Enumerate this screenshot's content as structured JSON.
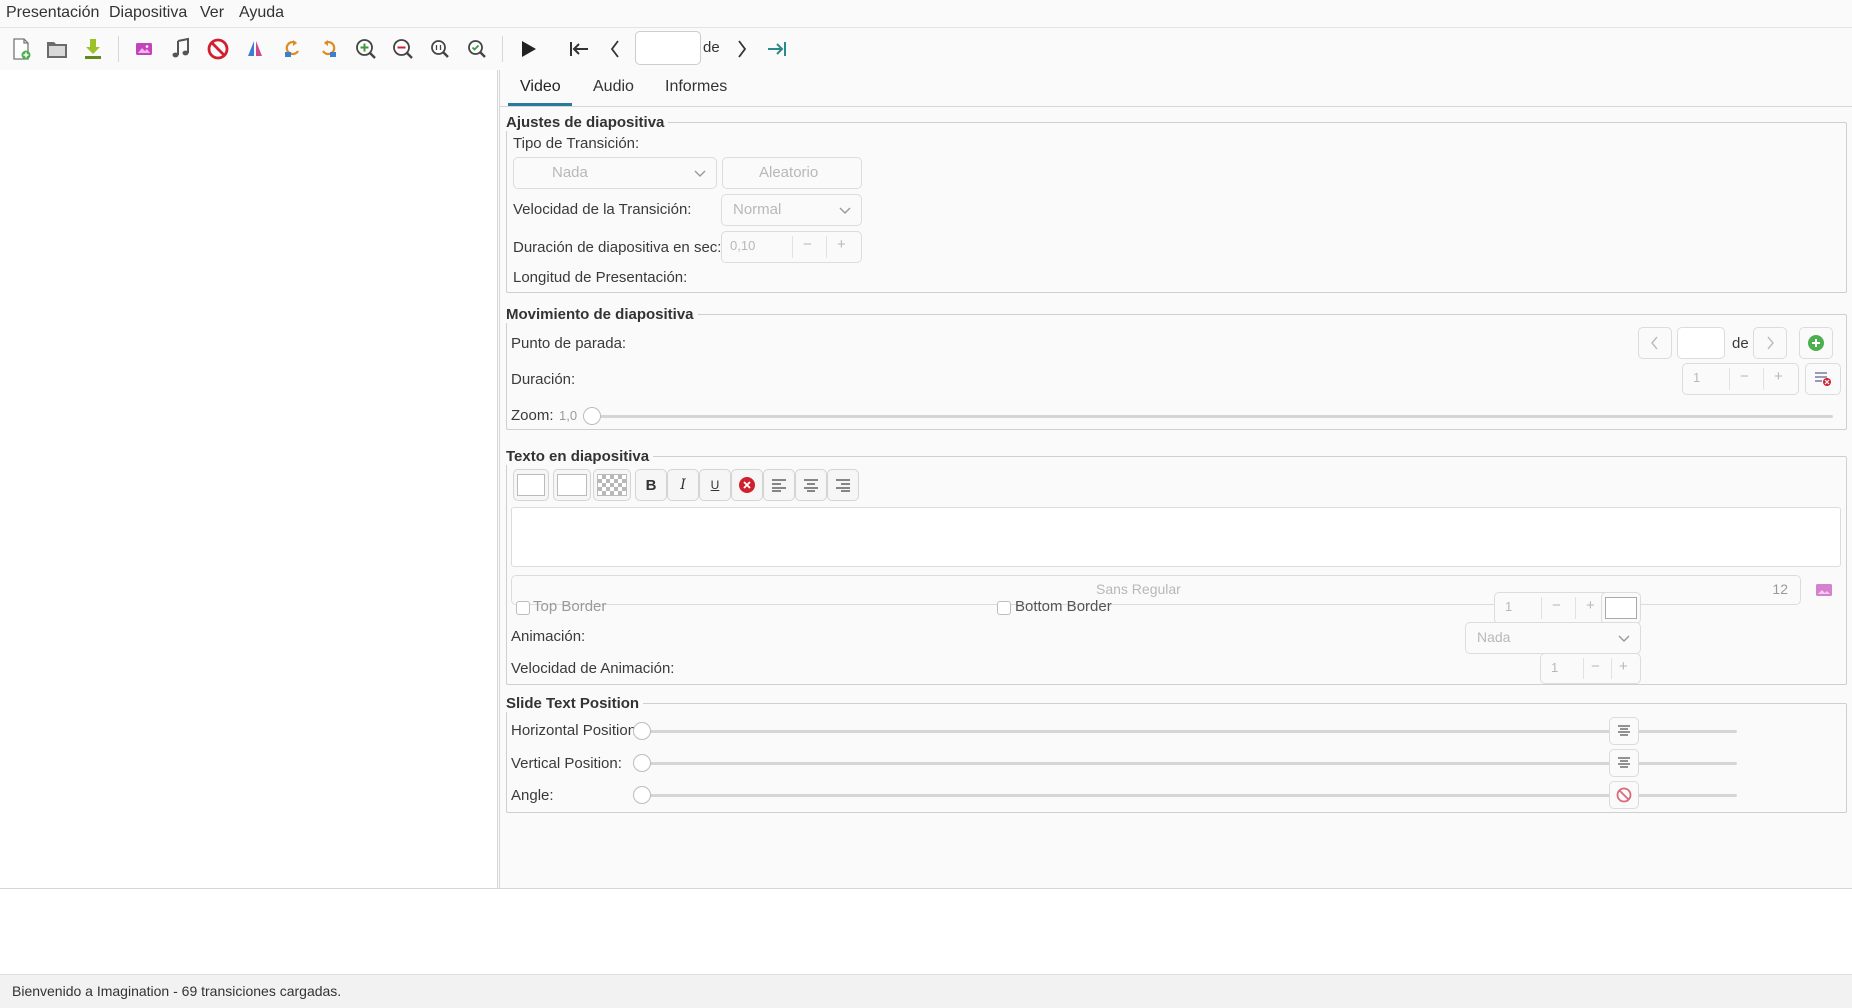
{
  "menubar": {
    "items": [
      "Presentación",
      "Diapositiva",
      "Ver",
      "Ayuda"
    ]
  },
  "toolbar": {
    "icons": [
      "new-document-icon",
      "open-folder-icon",
      "save-download-icon",
      "import-image-icon",
      "import-music-icon",
      "delete-icon",
      "flip-icon",
      "rotate-left-icon",
      "rotate-right-icon",
      "zoom-in-icon",
      "zoom-out-icon",
      "zoom-normal-icon",
      "zoom-fit-icon",
      "play-icon",
      "first-slide-icon",
      "previous-slide-icon",
      "next-slide-icon",
      "last-slide-icon"
    ],
    "slide_number_value": "",
    "of_label": "de"
  },
  "tabs": [
    "Video",
    "Audio",
    "Informes"
  ],
  "slide_settings": {
    "title": "Ajustes de diapositiva",
    "transition_type_label": "Tipo de Transición:",
    "transition_type_value": "Nada",
    "random_button": "Aleatorio",
    "transition_speed_label": "Velocidad de la Transición:",
    "transition_speed_value": "Normal",
    "duration_label": "Duración de diapositiva en sec:",
    "duration_value": "0,10",
    "length_label": "Longitud de Presentación:"
  },
  "slide_motion": {
    "title": "Movimiento de diapositiva",
    "stop_point_label": "Punto de parada:",
    "stop_point_value": "",
    "of_label": "de",
    "duration_label": "Duración:",
    "duration_value": "1",
    "zoom_label": "Zoom:",
    "zoom_value": "1,0",
    "zoom_level": 0
  },
  "slide_text": {
    "title": "Texto en diapositiva",
    "text_value": "",
    "font_value": "Sans Regular",
    "font_size": "12",
    "top_border_label": "Top Border",
    "bottom_border_label": "Bottom Border",
    "border_width_value": "1",
    "animation_label": "Animación:",
    "animation_value": "Nada",
    "animation_speed_label": "Velocidad de Animación:",
    "animation_speed_value": "1"
  },
  "text_position": {
    "title": "Slide Text Position",
    "horizontal_label": "Horizontal Position:",
    "vertical_label": "Vertical Position:",
    "angle_label": "Angle:",
    "horizontal_level": 0,
    "vertical_level": 0,
    "angle_level": 0
  },
  "colors": {
    "accent": "#2a7a9b",
    "delete_red": "#d0202e",
    "add_green": "#4caf50"
  },
  "statusbar": {
    "text": "Bienvenido a Imagination - 69 transiciones cargadas."
  }
}
